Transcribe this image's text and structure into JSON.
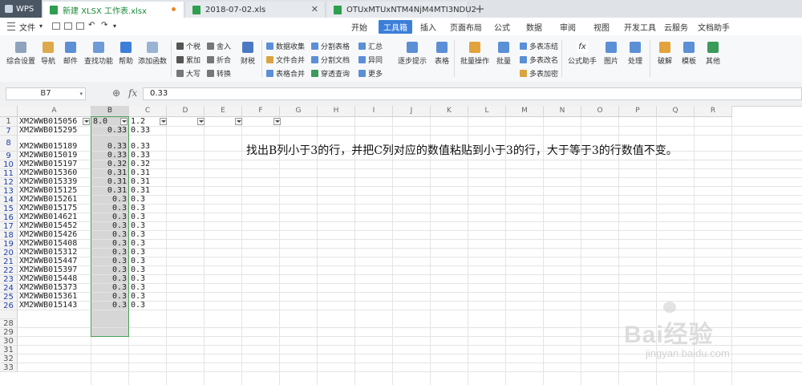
{
  "tabs": {
    "app": "WPS",
    "docs": [
      {
        "label": "新建 XLSX 工作表.xlsx",
        "active": true
      },
      {
        "label": "2018-07-02.xls",
        "active": false
      },
      {
        "label": "OTUxMTUxNTM4NjM4MTI3NDU2",
        "active": false
      }
    ]
  },
  "menu": {
    "file": "文件",
    "items": [
      "开始",
      "工具箱",
      "插入",
      "页面布局",
      "公式",
      "数据",
      "审阅",
      "视图",
      "开发工具",
      "云服务",
      "文档助手"
    ],
    "active": "工具箱"
  },
  "ribbon": {
    "general_settings": "综合设置",
    "navigation": "导航",
    "mail": "邮件",
    "find_function": "查找功能",
    "help": "帮助",
    "add_function": "添加函数",
    "tax": "个税",
    "accumulate": "累加",
    "uppercase": "大写",
    "round": "舍入",
    "fold": "折合",
    "convert": "转换",
    "finance": "财税",
    "data_collect": "数据收集",
    "file_merge": "文件合并",
    "table_merge": "表格合并",
    "split_table": "分割表格",
    "split_doc": "分割文档",
    "pivot_query": "穿透查询",
    "summary": "汇总",
    "diff": "异同",
    "more": "更多",
    "step_hint": "逐步提示",
    "table": "表格",
    "batch_ops": "批量操作",
    "batch": "批量",
    "multi_freeze": "多表冻结",
    "multi_rename": "多表改名",
    "multi_encrypt": "多表加密",
    "formula_helper": "公式助手",
    "picture": "图片",
    "process": "处理",
    "crack": "破解",
    "template": "模板",
    "other": "其他"
  },
  "formula_bar": {
    "cell_ref": "B7",
    "fx": "fx",
    "value": "0.33"
  },
  "columns": [
    "A",
    "B",
    "C",
    "D",
    "E",
    "F",
    "G",
    "H",
    "I",
    "J",
    "K",
    "L",
    "M",
    "N",
    "O",
    "P",
    "Q",
    "R"
  ],
  "selected_column": "B",
  "header_row": {
    "row": "1",
    "A": "XM2WWB015056",
    "B": "8.0",
    "C": "1.2"
  },
  "rows": [
    {
      "row": "7",
      "A": "XM2WWB015295",
      "B": "0.33",
      "C": "0.33"
    },
    {
      "row": "8",
      "A": "XM2WWB015189",
      "B": "0.33",
      "C": "0.33"
    },
    {
      "row": "9",
      "A": "XM2WWB015019",
      "B": "0.33",
      "C": "0.33"
    },
    {
      "row": "10",
      "A": "XM2WWB015197",
      "B": "0.32",
      "C": "0.32"
    },
    {
      "row": "11",
      "A": "XM2WWB015360",
      "B": "0.31",
      "C": "0.31"
    },
    {
      "row": "12",
      "A": "XM2WWB015339",
      "B": "0.31",
      "C": "0.31"
    },
    {
      "row": "13",
      "A": "XM2WWB015125",
      "B": "0.31",
      "C": "0.31"
    },
    {
      "row": "14",
      "A": "XM2WWB015261",
      "B": "0.3",
      "C": "0.3"
    },
    {
      "row": "15",
      "A": "XM2WWB015175",
      "B": "0.3",
      "C": "0.3"
    },
    {
      "row": "16",
      "A": "XM2WWB014621",
      "B": "0.3",
      "C": "0.3"
    },
    {
      "row": "17",
      "A": "XM2WWB015452",
      "B": "0.3",
      "C": "0.3"
    },
    {
      "row": "18",
      "A": "XM2WWB015426",
      "B": "0.3",
      "C": "0.3"
    },
    {
      "row": "19",
      "A": "XM2WWB015408",
      "B": "0.3",
      "C": "0.3"
    },
    {
      "row": "20",
      "A": "XM2WWB015312",
      "B": "0.3",
      "C": "0.3"
    },
    {
      "row": "21",
      "A": "XM2WWB015447",
      "B": "0.3",
      "C": "0.3"
    },
    {
      "row": "22",
      "A": "XM2WWB015397",
      "B": "0.3",
      "C": "0.3"
    },
    {
      "row": "23",
      "A": "XM2WWB015448",
      "B": "0.3",
      "C": "0.3"
    },
    {
      "row": "24",
      "A": "XM2WWB015373",
      "B": "0.3",
      "C": "0.3"
    },
    {
      "row": "25",
      "A": "XM2WWB015361",
      "B": "0.3",
      "C": "0.3"
    },
    {
      "row": "26",
      "A": "XM2WWB015143",
      "B": "0.3",
      "C": "0.3"
    }
  ],
  "empty_rows": [
    "28",
    "29",
    "30",
    "31",
    "32",
    "33"
  ],
  "note": "找出B列小于3的行，并把C列对应的数值粘贴到小于3的行，大于等于3的行数值不变。",
  "watermark": {
    "brand": "Bai经验",
    "url": "jingyan.baidu.com"
  },
  "colors": {
    "accent": "#3c7fd9",
    "selection_border": "#4aa056",
    "filtered_row_number": "#1f3fa8"
  }
}
